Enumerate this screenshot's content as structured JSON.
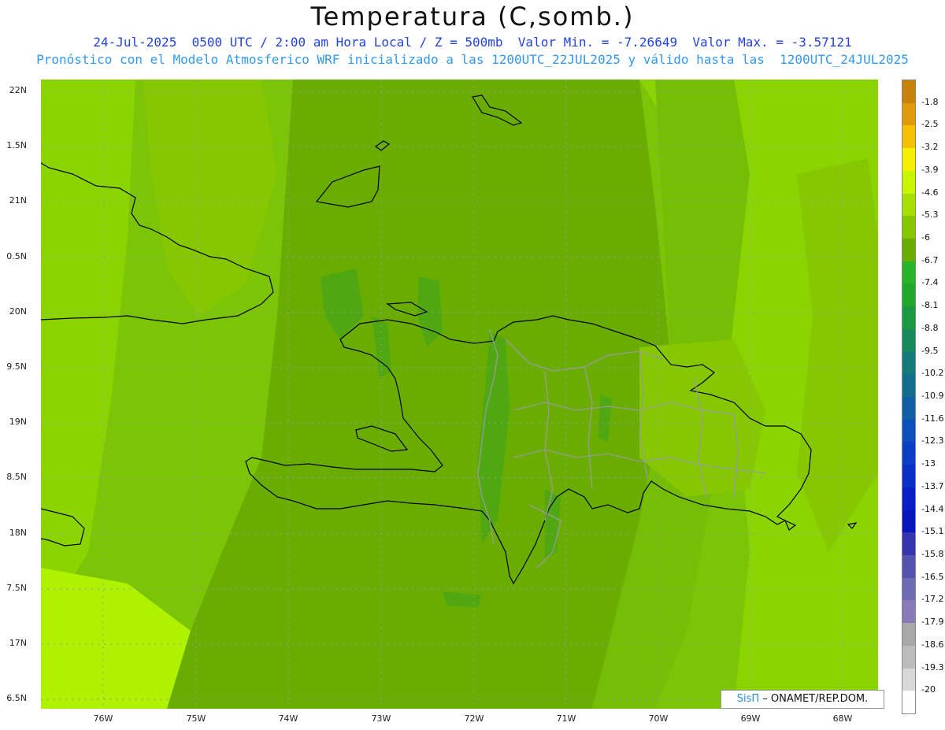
{
  "title": "Temperatura (C,somb.)",
  "subtitle1": "24-Jul-2025  0500 UTC / 2:00 am Hora Local / Z = 500mb  Valor Min. = -7.26649  Valor Max. = -3.57121",
  "subtitle2": "Pronóstico con el Modelo Atmosferico WRF inicializado a las 1200UTC_22JUL2025 y válido hasta las  1200UTC_24JUL2025",
  "lat_labels": [
    "22N",
    "1.5N",
    "21N",
    "0.5N",
    "20N",
    "9.5N",
    "19N",
    "8.5N",
    "18N",
    "7.5N",
    "17N",
    "6.5N"
  ],
  "lon_labels": [
    "76W",
    "75W",
    "74W",
    "73W",
    "72W",
    "71W",
    "70W",
    "69W",
    "68W"
  ],
  "colorbar": {
    "labels": [
      "-1.8",
      "-2.5",
      "-3.2",
      "-3.9",
      "-4.6",
      "-5.3",
      "-6",
      "-6.7",
      "-7.4",
      "-8.1",
      "-8.8",
      "-9.5",
      "-10.2",
      "-10.9",
      "-11.6",
      "-12.3",
      "-13",
      "-13.7",
      "-14.4",
      "-15.1",
      "-15.8",
      "-16.5",
      "-17.2",
      "-17.9",
      "-18.6",
      "-19.3",
      "-20"
    ],
    "colors": [
      "#c8820a",
      "#e09a0a",
      "#f5c000",
      "#f5f000",
      "#c8f500",
      "#a6e000",
      "#86c800",
      "#6aac00",
      "#28b428",
      "#20a828",
      "#1a9a40",
      "#168a5a",
      "#147a7a",
      "#126e8e",
      "#1060a6",
      "#0c50ba",
      "#0a3ec4",
      "#0a2ec8",
      "#0a1ec8",
      "#0a14bc",
      "#3434b0",
      "#5454b0",
      "#6e6ab4",
      "#8a7ab8",
      "#a8a8a8",
      "#bcbcbc",
      "#d8d8d8",
      "#ffffff"
    ]
  },
  "credit": {
    "sis": "SisΠ",
    "org": " – ONAMET/REP.DOM."
  },
  "colors": {
    "base": "#79c108",
    "light": "#8ad500",
    "lighter": "#aef200",
    "dark": "#69ad00",
    "darker": "#4fa812",
    "grid": "#9a9a9a",
    "border": "#9a9a9a"
  }
}
